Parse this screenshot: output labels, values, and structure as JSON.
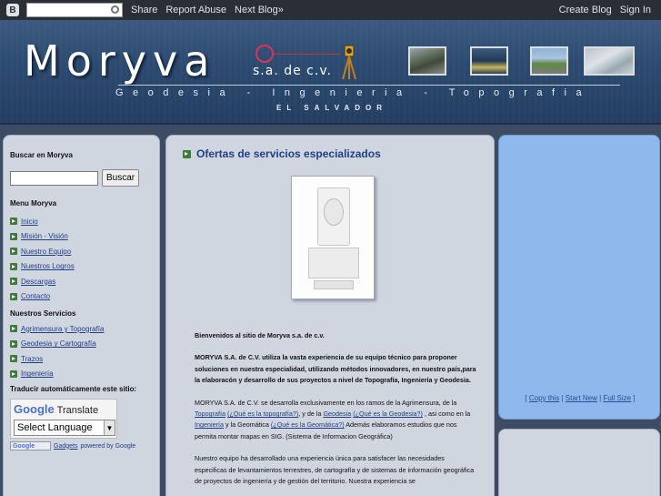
{
  "navbar": {
    "share": "Share",
    "report_abuse": "Report Abuse",
    "next_blog": "Next Blog»",
    "create_blog": "Create Blog",
    "sign_in": "Sign In"
  },
  "header": {
    "title": "Moryva",
    "subtitle": "s.a. de c.v.",
    "tagline": "Geodesia  -  Ingenieria  -  Topografia",
    "country": "EL SALVADOR"
  },
  "sidebar": {
    "search_title": "Buscar en Moryva",
    "search_button": "Buscar",
    "menu_title": "Menu Moryva",
    "menu_items": [
      "Inicio",
      "Misión - Visión",
      "Nuestro Equipo",
      "Nuestros Logros",
      "Descargas",
      "Contacto"
    ],
    "services_title": "Nuestros Servicios",
    "services_items": [
      "Agrimensura y Topografía",
      "Geodesia y Cartografía",
      "Trazos",
      "Ingeniería"
    ],
    "translate_title": "Traducir automáticamente este sitio:",
    "google_translate": "Translate",
    "google_g": "Google",
    "language_select": "Select Language",
    "gadgets_link": "Gadgets",
    "powered_by": "powered by Google",
    "gadgets_logo": "Google"
  },
  "main": {
    "post_title": "Ofertas de servicios especializados",
    "p1": "Bienvenidos al sitio de Moryva s.a. de c.v.",
    "p2": "MORYVA S.A. de C.V. utiliza la vasta experiencia de su equipo técnico para proponer soluciones en nuestra especialidad, utilizando métodos innovadores, en nuestro país,para la elaboracón y desarrollo de sus proyectos a nivel de Topografía, Ingeniería y Geodesia.",
    "p3_a": "MORYVA S.A. de C.V. se desarrolla exclusivamente en los ramos de la Agrimensura, de la ",
    "link_topografia": "Topografía",
    "link_que_topografia": "(¿Qué es la topografía?)",
    "p3_b": ", y de la ",
    "link_geodesia": "Geodesia",
    "link_que_geodesia": "(¿Qué es la Geodesia?)",
    "p3_c": " , asi como en la ",
    "link_ingenieria": "Ingeniería",
    "p3_d": " y la Geomática ",
    "link_que_geomatica": "(¿Qué es la Geomática?)",
    "p3_e": " Además elaboramos estudios que nos permita montar mapas en SIG. (Sistema de Informacion Geográfica)",
    "p4": "Nuestro equipo ha desarrollado una experiencia única para satisfacer las necesidades especificas de levantamientos terrestres, de cartografía y de sistemas de información geográfica de proyectos de ingeniería y de gestión del territorio. Nuestra experiencia se"
  },
  "right": {
    "open_bracket": "[",
    "copy_this": "Copy this",
    "start_new": "Start New",
    "full_size": "Full Size",
    "close_bracket": "]",
    "sep": "|"
  },
  "colors": {
    "accent": "#233e86",
    "header_blue": "#2c4a70",
    "sidebar_bg": "#cfd6e0",
    "right_blue": "#8fb8ec"
  }
}
